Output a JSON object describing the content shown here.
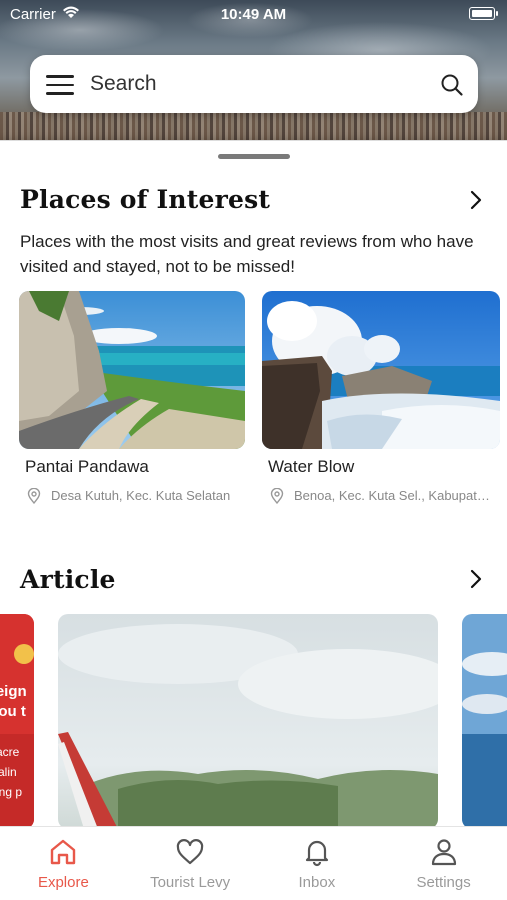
{
  "status_bar": {
    "carrier": "Carrier",
    "time": "10:49 AM"
  },
  "search": {
    "placeholder": "Search"
  },
  "places": {
    "title": "Places of Interest",
    "description": "Places with the most visits and great reviews from who have visited and stayed, not to be missed!",
    "items": [
      {
        "name": "Pantai Pandawa",
        "location": "Desa Kutuh, Kec. Kuta Selatan"
      },
      {
        "name": "Water Blow",
        "location": "Benoa, Kec. Kuta Sel., Kabupaten Badung"
      }
    ]
  },
  "article": {
    "title": "Article",
    "left_card_text": [
      "reign",
      "you t",
      "sacre",
      "Balin",
      "ving p"
    ]
  },
  "tabs": [
    {
      "label": "Explore",
      "icon": "home-icon",
      "active": true
    },
    {
      "label": "Tourist Levy",
      "icon": "heart-icon",
      "active": false
    },
    {
      "label": "Inbox",
      "icon": "bell-icon",
      "active": false
    },
    {
      "label": "Settings",
      "icon": "person-icon",
      "active": false
    }
  ],
  "colors": {
    "accent": "#e8584a",
    "inactive": "#9a9a9a"
  }
}
